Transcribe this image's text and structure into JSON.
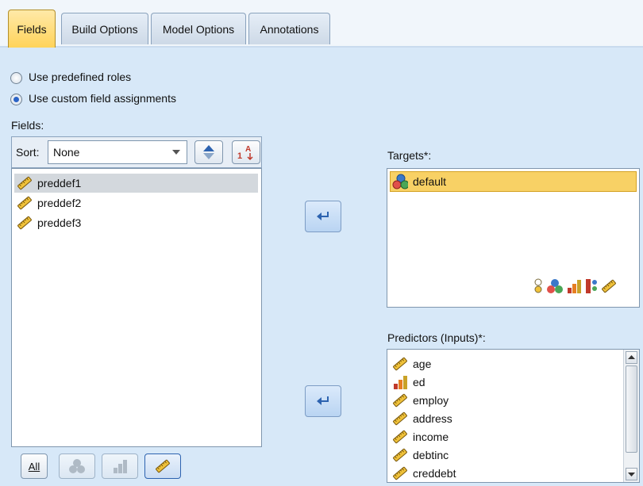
{
  "tabs": [
    {
      "label": "Fields",
      "active": true
    },
    {
      "label": "Build Options",
      "active": false
    },
    {
      "label": "Model Options",
      "active": false
    },
    {
      "label": "Annotations",
      "active": false
    }
  ],
  "roles": {
    "predefined_label": "Use predefined roles",
    "custom_label": "Use custom field assignments",
    "selected": "custom"
  },
  "fields": {
    "heading": "Fields:",
    "sort_label": "Sort:",
    "sort_value": "None",
    "items": [
      {
        "name": "preddef1",
        "icon": "continuous-ruler-icon",
        "selected": true
      },
      {
        "name": "preddef2",
        "icon": "continuous-ruler-icon",
        "selected": false
      },
      {
        "name": "preddef3",
        "icon": "continuous-ruler-icon",
        "selected": false
      }
    ],
    "filter_buttons": {
      "all_label": "All"
    }
  },
  "targets": {
    "heading": "Targets*:",
    "items": [
      {
        "name": "default",
        "icon": "nominal-set-icon",
        "selected": true
      }
    ]
  },
  "predictors": {
    "heading": "Predictors (Inputs)*:",
    "items": [
      {
        "name": "age",
        "icon": "continuous-ruler-icon"
      },
      {
        "name": "ed",
        "icon": "ordinal-bars-icon"
      },
      {
        "name": "employ",
        "icon": "continuous-ruler-icon"
      },
      {
        "name": "address",
        "icon": "continuous-ruler-icon"
      },
      {
        "name": "income",
        "icon": "continuous-ruler-icon"
      },
      {
        "name": "debtinc",
        "icon": "continuous-ruler-icon"
      },
      {
        "name": "creddebt",
        "icon": "continuous-ruler-icon"
      }
    ]
  },
  "colors": {
    "accent_tab": "#ffd35a",
    "selection_target": "#f8d165",
    "selection_field": "#d3d8dd",
    "move_arrow": "#2d63b0"
  }
}
